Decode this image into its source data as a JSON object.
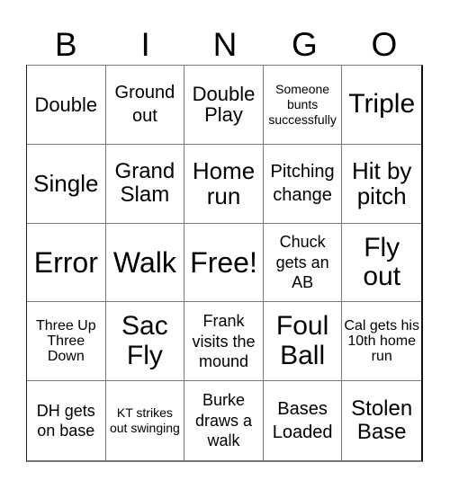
{
  "header": [
    "B",
    "I",
    "N",
    "G",
    "O"
  ],
  "cells": [
    "Double",
    "Ground out",
    "Double Play",
    "Someone bunts successfully",
    "Triple",
    "Single",
    "Grand Slam",
    "Home run",
    "Pitching change",
    "Hit by pitch",
    "Error",
    "Walk",
    "Free!",
    "Chuck gets an AB",
    "Fly out",
    "Three Up Three Down",
    "Sac Fly",
    "Frank visits the mound",
    "Foul Ball",
    "Cal gets his 10th home run",
    "DH gets on base",
    "KT strikes out swinging",
    "Burke draws a walk",
    "Bases Loaded",
    "Stolen Base"
  ]
}
